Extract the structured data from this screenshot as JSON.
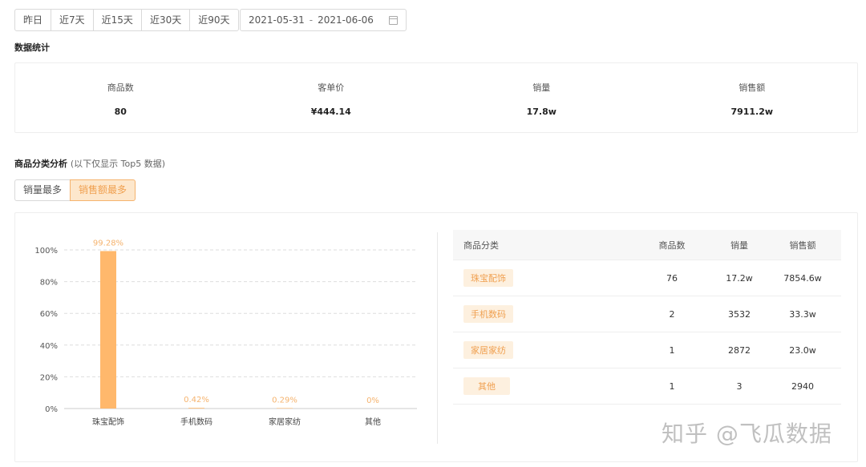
{
  "date_buttons": [
    "昨日",
    "近7天",
    "近15天",
    "近30天",
    "近90天"
  ],
  "date_range": {
    "start": "2021-05-31",
    "separator": "-",
    "end": "2021-06-06"
  },
  "stats_title": "数据统计",
  "stats": [
    {
      "label": "商品数",
      "value": "80"
    },
    {
      "label": "客单价",
      "value": "¥444.14"
    },
    {
      "label": "销量",
      "value": "17.8w"
    },
    {
      "label": "销售额",
      "value": "7911.2w"
    }
  ],
  "category_title": "商品分类分析",
  "category_subtitle": "(以下仅显示 Top5 数据)",
  "toggle": {
    "option1": "销量最多",
    "option2": "销售额最多",
    "active": "option2"
  },
  "chart_data": {
    "type": "bar",
    "categories": [
      "珠宝配饰",
      "手机数码",
      "家居家纺",
      "其他"
    ],
    "values": [
      99.28,
      0.42,
      0.29,
      0
    ],
    "data_labels": [
      "99.28%",
      "0.42%",
      "0.29%",
      "0%"
    ],
    "y_ticks": [
      "0%",
      "20%",
      "40%",
      "60%",
      "80%",
      "100%"
    ],
    "ylim": [
      0,
      100
    ],
    "grid": true,
    "bar_color": "#ffb86c",
    "label_color": "#f5b36e"
  },
  "table": {
    "headers": [
      "商品分类",
      "商品数",
      "销量",
      "销售额"
    ],
    "rows": [
      {
        "category": "珠宝配饰",
        "count": "76",
        "sales": "17.2w",
        "revenue": "7854.6w"
      },
      {
        "category": "手机数码",
        "count": "2",
        "sales": "3532",
        "revenue": "33.3w"
      },
      {
        "category": "家居家纺",
        "count": "1",
        "sales": "2872",
        "revenue": "23.0w"
      },
      {
        "category": "其他",
        "count": "1",
        "sales": "3",
        "revenue": "2940"
      }
    ]
  },
  "watermark": "知乎 @飞瓜数据"
}
